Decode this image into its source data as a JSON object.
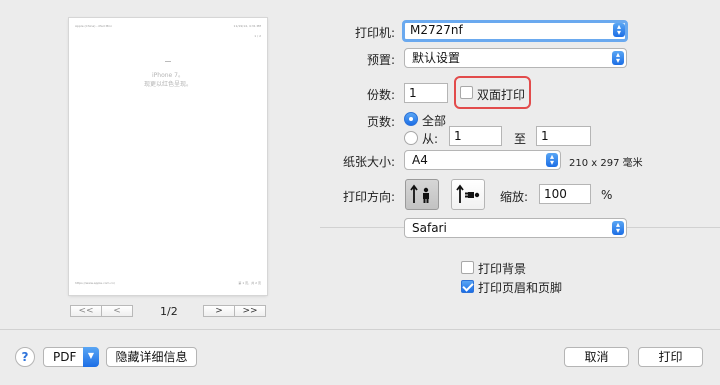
{
  "preview": {
    "header_left": "Apple (China) - iPad Mini",
    "header_right": "11/19/14, 4:31 PM",
    "header_right2": "1 / 2",
    "line1": "iPhone 7。",
    "line2": "现更以红色呈现。",
    "footer_left": "https://www.apple.com.cn/",
    "footer_right": "第 1 页，共 2 页",
    "nav": {
      "first": "<<",
      "prev": "<",
      "next": ">",
      "last": ">>"
    },
    "page_indicator": "1/2"
  },
  "printer": {
    "label": "打印机:",
    "value": "M2727nf"
  },
  "presets": {
    "label": "预置:",
    "value": "默认设置"
  },
  "copies": {
    "label": "份数:",
    "value": "1",
    "duplex_label": "双面打印",
    "duplex_checked": false
  },
  "pages": {
    "label": "页数:",
    "all_label": "全部",
    "all_selected": true,
    "from_label": "从:",
    "from_value": "1",
    "to_label": "至",
    "to_value": "1"
  },
  "paper_size": {
    "label": "纸张大小:",
    "value": "A4",
    "dimensions": "210 x 297 毫米"
  },
  "orientation": {
    "label": "打印方向:",
    "portrait_selected": true,
    "scale_label": "缩放:",
    "scale_value": "100",
    "scale_unit": "%"
  },
  "app_section": {
    "value": "Safari"
  },
  "options": {
    "print_backgrounds": {
      "label": "打印背景",
      "checked": false
    },
    "print_headers_footers": {
      "label": "打印页眉和页脚",
      "checked": true
    }
  },
  "footer": {
    "help": "?",
    "pdf_label": "PDF",
    "hide_details": "隐藏详细信息",
    "cancel": "取消",
    "print": "打印"
  },
  "colors": {
    "accent": "#1c6ee6",
    "highlight_box": "#e24b4b"
  }
}
